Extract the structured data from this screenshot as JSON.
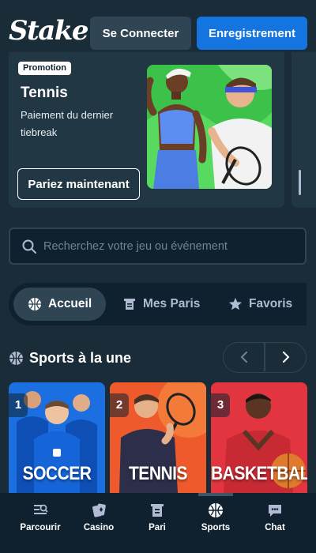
{
  "header": {
    "logo": "Stake",
    "login_label": "Se Connecter",
    "register_label": "Enregistrement"
  },
  "promo": {
    "badge": "Promotion",
    "title": "Tennis",
    "description": "Paiement du dernier tiebreak",
    "cta_label": "Pariez maintenant"
  },
  "search": {
    "placeholder": "Recherchez votre jeu ou événement",
    "value": ""
  },
  "tabs": [
    {
      "label": "Accueil",
      "icon": "basketball-icon",
      "active": true
    },
    {
      "label": "Mes Paris",
      "icon": "bets-icon",
      "active": false
    },
    {
      "label": "Favoris",
      "icon": "star-icon",
      "active": false
    }
  ],
  "featured": {
    "title": "Sports à la une",
    "cards": [
      {
        "rank": "1",
        "label": "SOCCER",
        "color": "#1565d8"
      },
      {
        "rank": "2",
        "label": "TENNIS",
        "color": "#f0562a"
      },
      {
        "rank": "3",
        "label": "BASKETBALL",
        "color": "#e0353d"
      }
    ]
  },
  "bottom_nav": [
    {
      "label": "Parcourir",
      "icon": "browse-icon"
    },
    {
      "label": "Casino",
      "icon": "casino-icon"
    },
    {
      "label": "Pari",
      "icon": "bet-slip-icon"
    },
    {
      "label": "Sports",
      "icon": "sports-icon",
      "active": true
    },
    {
      "label": "Chat",
      "icon": "chat-icon"
    }
  ],
  "colors": {
    "background": "#1a2c38",
    "surface": "#213743",
    "dark": "#0f212e",
    "accent": "#1475e1"
  }
}
